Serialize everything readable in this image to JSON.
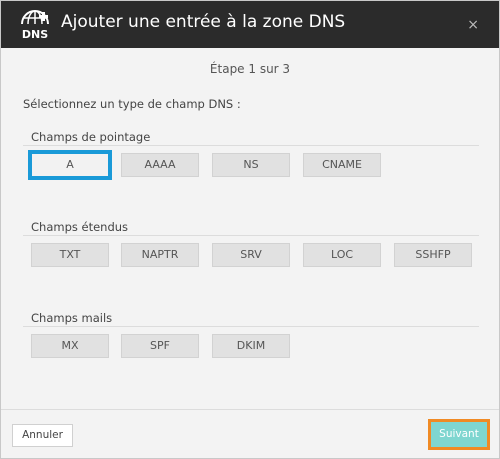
{
  "header": {
    "logo_text": "DNS",
    "title": "Ajouter une entrée à la zone DNS",
    "close_glyph": "×"
  },
  "step": "Étape 1 sur 3",
  "prompt": "Sélectionnez un type de champ DNS :",
  "sections": [
    {
      "title": "Champs de pointage",
      "buttons": [
        "A",
        "AAAA",
        "NS",
        "CNAME"
      ]
    },
    {
      "title": "Champs étendus",
      "buttons": [
        "TXT",
        "NAPTR",
        "SRV",
        "LOC",
        "SSHFP"
      ]
    },
    {
      "title": "Champs mails",
      "buttons": [
        "MX",
        "SPF",
        "DKIM"
      ]
    }
  ],
  "selected_type": "A",
  "footer": {
    "cancel_label": "Annuler",
    "next_label": "Suivant"
  },
  "colors": {
    "header_bg": "#2b2b2b",
    "selection_outline": "#1a9ad8",
    "next_button": "#7fd6d0",
    "next_highlight": "#f08a24"
  }
}
